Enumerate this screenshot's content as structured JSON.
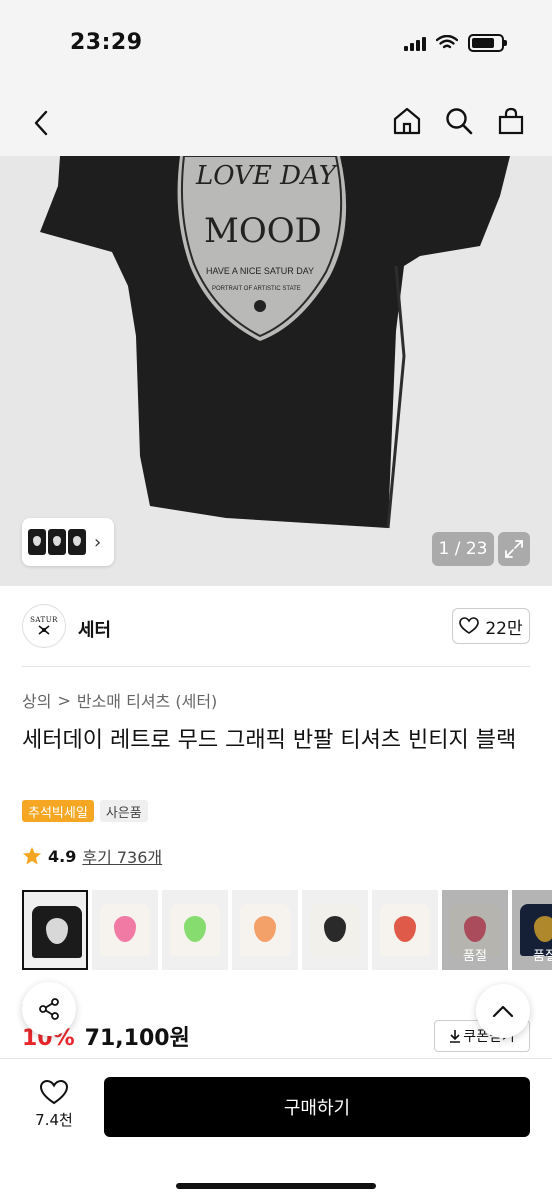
{
  "status": {
    "time": "23:29"
  },
  "nav": {
    "back_icon": "chevron-left-icon",
    "icons": [
      "home-icon",
      "search-icon",
      "shopping-bag-icon"
    ]
  },
  "hero": {
    "counter": "1 / 23",
    "shirt_text": {
      "line1": "LOVE DAY",
      "line2": "MOOD",
      "line3": "HAVE A NICE SATUR DAY",
      "line4": "PORTRAIT OF ARTISTIC STATE"
    }
  },
  "brand": {
    "logo_text": "SATUR",
    "name": "세터",
    "likes": "22만"
  },
  "breadcrumb": {
    "cat1": "상의",
    "sep": ">",
    "cat2": "반소매 티셔츠 (세터)"
  },
  "product": {
    "title": "세터데이 레트로 무드 그래픽 반팔 티셔츠 빈티지 블랙",
    "badge_sale": "추석빅세일",
    "badge_gift": "사은품",
    "rating": "4.9",
    "reviews": "후기 736개"
  },
  "variants": [
    {
      "tee": "#1b1b1b",
      "heart": "#d8d8d8",
      "selected": true,
      "sold_out": false
    },
    {
      "tee": "#f6f3ee",
      "heart": "#f07aa4",
      "selected": false,
      "sold_out": false
    },
    {
      "tee": "#f6f3ee",
      "heart": "#86dc6f",
      "selected": false,
      "sold_out": false
    },
    {
      "tee": "#f6f3ee",
      "heart": "#f4a069",
      "selected": false,
      "sold_out": false
    },
    {
      "tee": "#f2f0ea",
      "heart": "#2a2a2a",
      "selected": false,
      "sold_out": false
    },
    {
      "tee": "#f6f3ee",
      "heart": "#e05a4a",
      "selected": false,
      "sold_out": false
    },
    {
      "tee": "#f2f0ea",
      "heart": "#e3667a",
      "selected": false,
      "sold_out": true
    },
    {
      "tee": "#1d2b4a",
      "heart": "#e8b63a",
      "selected": false,
      "sold_out": true
    }
  ],
  "sold_out_label": "품절",
  "price": {
    "original": "원",
    "discount": "10%",
    "final": "71,100원",
    "coupon": "쿠폰받기"
  },
  "bottom": {
    "wish_count": "7.4천",
    "buy_label": "구매하기"
  },
  "colors": {
    "accent_sale": "#f5a623",
    "discount_red": "#e8262b",
    "star": "#f5a623"
  }
}
